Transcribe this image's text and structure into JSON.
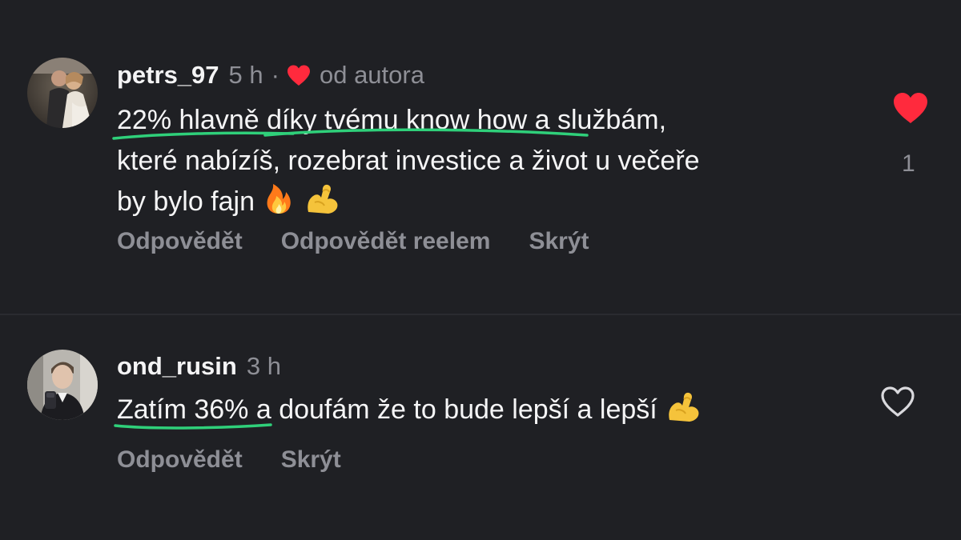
{
  "comments": [
    {
      "username": "petrs_97",
      "time": "5 h",
      "separator": "·",
      "badge": "od autora",
      "badge_icon": "heart-icon",
      "text_parts": {
        "hl1": "22% hlavně",
        "space1": " ",
        "hl2": "díky tvému know how",
        "rest1": " a službám,",
        "line2": "které nabízíš, rozebrat investice a život u večeře",
        "line3": "by bylo fajn "
      },
      "emojis": [
        "fire-emoji",
        "flexed-biceps-emoji"
      ],
      "actions": {
        "reply": "Odpovědět",
        "reply_reel": "Odpovědět reelem",
        "hide": "Skrýt"
      },
      "liked": true,
      "like_count": "1"
    },
    {
      "username": "ond_rusin",
      "time": "3 h",
      "text_parts": {
        "hl1": "Zatím 36%",
        "rest1": " a doufám že to bude lepší a lepší "
      },
      "emojis": [
        "flexed-biceps-emoji"
      ],
      "actions": {
        "reply": "Odpovědět",
        "hide": "Skrýt"
      },
      "liked": false
    }
  ],
  "colors": {
    "background": "#1f2024",
    "heart": "#ff2a3d",
    "highlight_underline": "#2fd07a",
    "muted": "#8e8f96"
  }
}
